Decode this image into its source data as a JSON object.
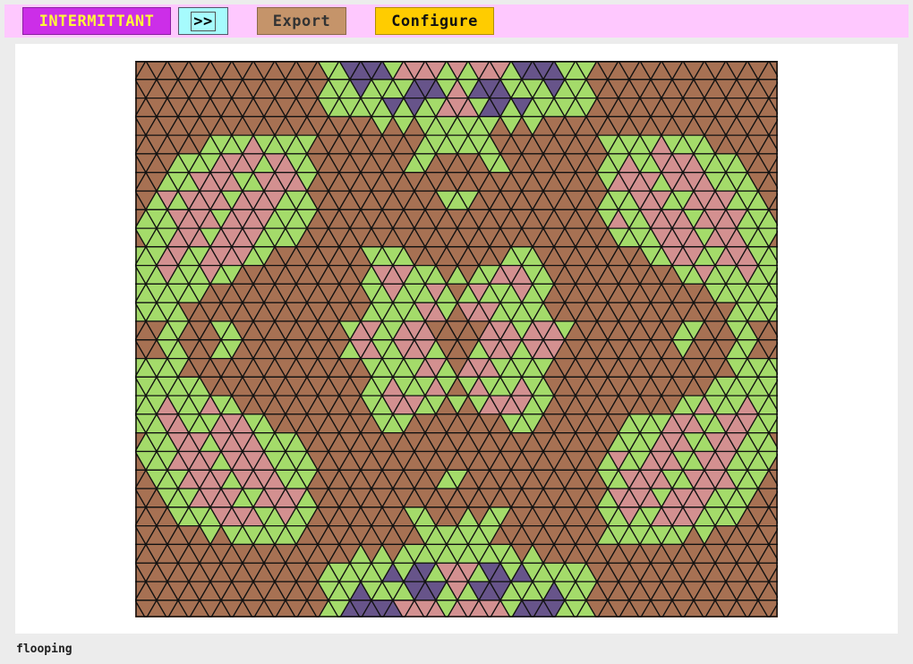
{
  "toolbar": {
    "mode_label": "INTERMITTANT",
    "next_label": ">>",
    "export_label": "Export",
    "configure_label": "Configure"
  },
  "status": {
    "text": "flooping"
  },
  "palette": {
    "green": "#a4db6a",
    "brown": "#a77153",
    "pink": "#d39090",
    "purple": "#67548a",
    "line": "#111111"
  }
}
